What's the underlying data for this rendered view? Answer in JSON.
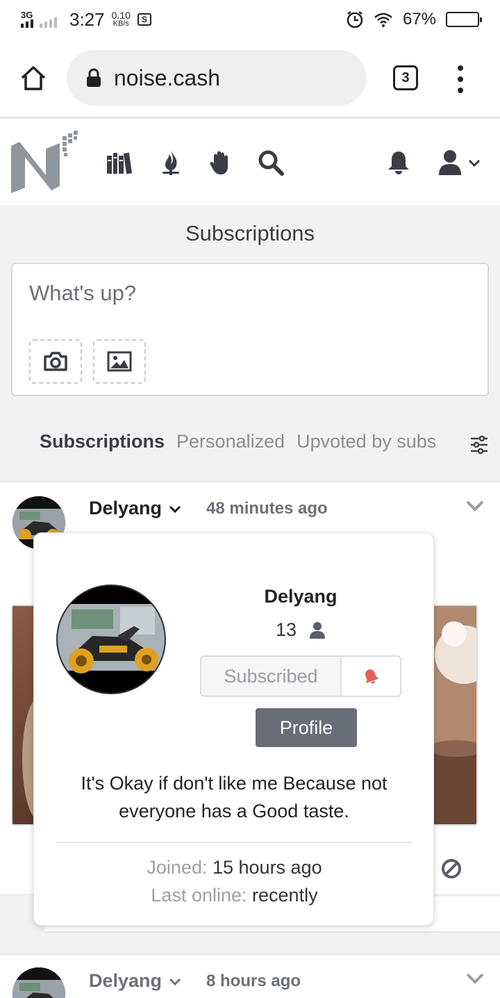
{
  "status_bar": {
    "network": "3G",
    "time": "3:27",
    "speed_value": "0.10",
    "speed_unit": "KB/s",
    "battery": "67%",
    "battery_level": 0.67
  },
  "browser": {
    "url": "noise.cash",
    "tab_count": "3"
  },
  "site": {
    "nav_icons": [
      "library-icon",
      "fire-icon",
      "hand-icon",
      "search-icon"
    ],
    "right_icons": [
      "bell-icon",
      "user-icon"
    ]
  },
  "page": {
    "title": "Subscriptions"
  },
  "composer": {
    "placeholder": "What's up?"
  },
  "feed_tabs": [
    {
      "label": "Subscriptions",
      "active": true
    },
    {
      "label": "Personalized",
      "active": false
    },
    {
      "label": "Upvoted by subs",
      "active": false
    }
  ],
  "posts": [
    {
      "author": "Delyang",
      "time": "48 minutes ago"
    },
    {
      "author": "Delyang",
      "time": "8 hours ago"
    }
  ],
  "popover": {
    "name": "Delyang",
    "subscriber_count": "13",
    "subscribed_label": "Subscribed",
    "profile_label": "Profile",
    "bio": "It's Okay if don't like me Because not everyone has a Good taste.",
    "joined_label": "Joined:",
    "joined_value": "15 hours ago",
    "last_online_label": "Last online:",
    "last_online_value": "recently"
  },
  "colors": {
    "accent_button": "#696d77",
    "bell_red": "#e0605a",
    "logo_gray": "#8f979d"
  }
}
